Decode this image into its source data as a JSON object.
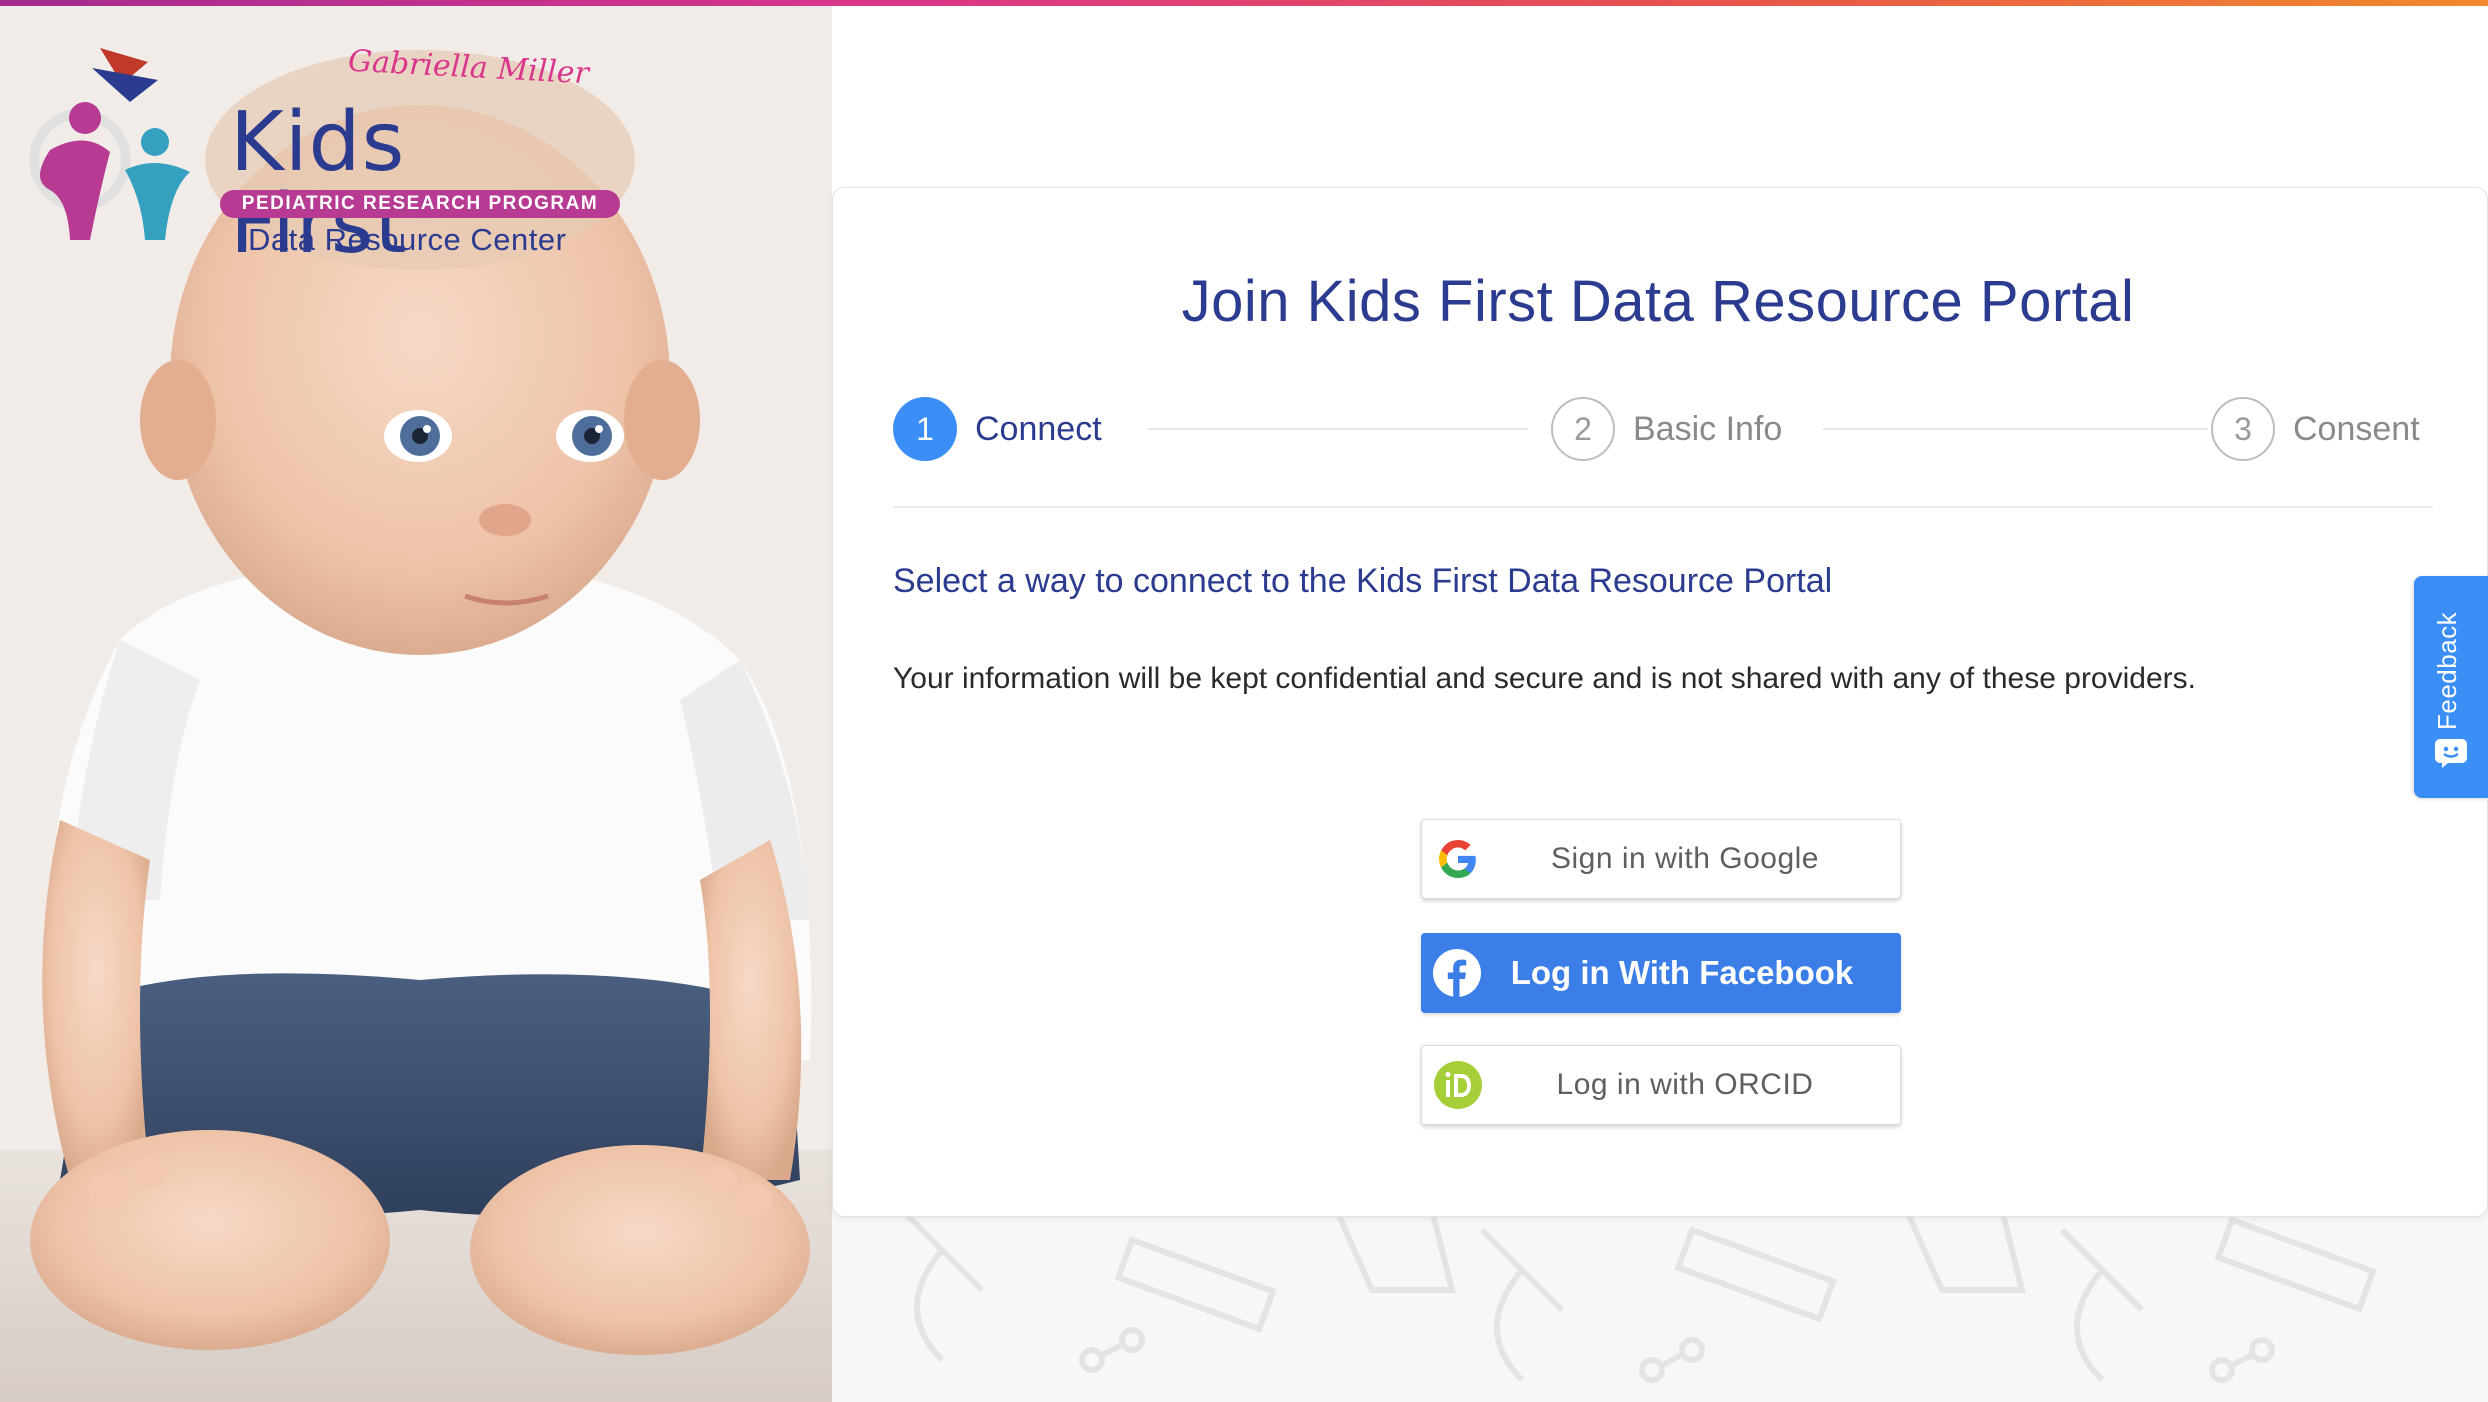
{
  "logo": {
    "script_text": "Gabriella Miller",
    "main_text": "Kids First",
    "program_text": "PEDIATRIC RESEARCH PROGRAM",
    "sub_text": "Data Resource Center"
  },
  "card": {
    "title": "Join Kids First Data Resource Portal",
    "steps": [
      {
        "number": "1",
        "label": "Connect",
        "state": "active"
      },
      {
        "number": "2",
        "label": "Basic Info",
        "state": "inactive"
      },
      {
        "number": "3",
        "label": "Consent",
        "state": "inactive"
      }
    ],
    "heading": "Select a way to connect to the Kids First Data Resource Portal",
    "info": "Your information will be kept confidential and secure and is not shared with any of these providers.",
    "buttons": {
      "google": {
        "label": "Sign in with Google",
        "icon": "google-icon"
      },
      "facebook": {
        "label": "Log in With Facebook",
        "icon": "facebook-icon"
      },
      "orcid": {
        "label": "Log in with ORCID",
        "icon": "orcid-icon"
      }
    }
  },
  "feedback": {
    "label": "Feedback",
    "icon": "chat-icon"
  },
  "colors": {
    "accent_blue": "#3a8ef6",
    "navy": "#2b3b8f",
    "facebook_blue": "#3b7ee8",
    "brand_pink": "#b73a93"
  }
}
